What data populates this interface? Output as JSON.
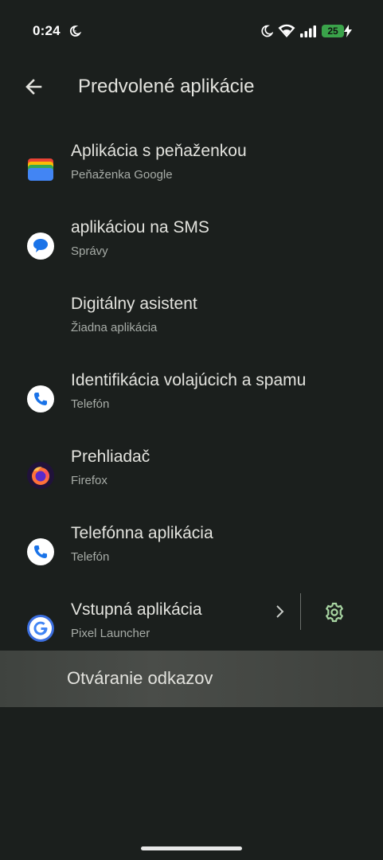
{
  "status_bar": {
    "time": "0:24",
    "battery_level": "25",
    "icons": [
      "dnd-moon-icon",
      "bedtime-icon",
      "wifi-icon",
      "signal-icon",
      "battery-icon",
      "charging-icon"
    ]
  },
  "header": {
    "title": "Predvolené aplikácie",
    "back_icon": "arrow-back-icon"
  },
  "items": [
    {
      "title": "Aplikácia s peňaženkou",
      "subtitle": "Peňaženka Google",
      "icon": "google-wallet-icon"
    },
    {
      "title": "aplikáciou na SMS",
      "subtitle": "Správy",
      "icon": "google-messages-icon"
    },
    {
      "title": "Digitálny asistent",
      "subtitle": "Žiadna aplikácia",
      "icon": ""
    },
    {
      "title": "Identifikácia volajúcich a spamu",
      "subtitle": "Telefón",
      "icon": "google-phone-icon"
    },
    {
      "title": "Prehliadač",
      "subtitle": "Firefox",
      "icon": "firefox-icon"
    },
    {
      "title": "Telefónna aplikácia",
      "subtitle": "Telefón",
      "icon": "google-phone-icon"
    },
    {
      "title": "Vstupná aplikácia",
      "subtitle": "Pixel Launcher",
      "icon": "google-g-icon"
    }
  ],
  "open_links": {
    "label": "Otváranie odkazov"
  },
  "colors": {
    "background": "#1b1f1d",
    "text_primary": "#e3e3de",
    "text_secondary": "#a7aca7",
    "accent_green": "#a8d5a2",
    "battery_green": "#3aa34a",
    "highlight_row": "#454844"
  }
}
